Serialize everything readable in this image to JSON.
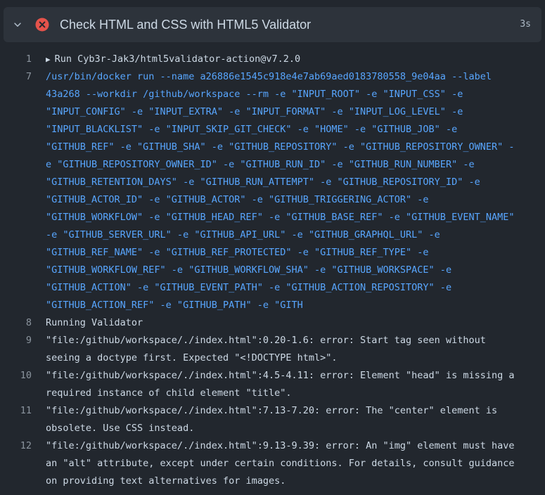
{
  "step": {
    "title": "Check HTML and CSS with HTML5 Validator",
    "duration": "3s",
    "status": "failed",
    "colors": {
      "failed": "#e5534b",
      "command": "#58a6ff",
      "text": "#cdd9e5",
      "line_number": "#8b949e",
      "background": "#22272e",
      "header_background": "#2d333b"
    }
  },
  "log": [
    {
      "number": "1",
      "kind": "group",
      "rows": [
        "Run Cyb3r-Jak3/html5validator-action@v7.2.0"
      ]
    },
    {
      "number": "7",
      "kind": "command",
      "rows": [
        "/usr/bin/docker run --name a26886e1545c918e4e7ab69aed0183780558_9e04aa --label",
        "43a268 --workdir /github/workspace --rm -e \"INPUT_ROOT\" -e \"INPUT_CSS\" -e",
        "\"INPUT_CONFIG\" -e \"INPUT_EXTRA\" -e \"INPUT_FORMAT\" -e \"INPUT_LOG_LEVEL\" -e",
        "\"INPUT_BLACKLIST\" -e \"INPUT_SKIP_GIT_CHECK\" -e \"HOME\" -e \"GITHUB_JOB\" -e",
        "\"GITHUB_REF\" -e \"GITHUB_SHA\" -e \"GITHUB_REPOSITORY\" -e \"GITHUB_REPOSITORY_OWNER\" -",
        "e \"GITHUB_REPOSITORY_OWNER_ID\" -e \"GITHUB_RUN_ID\" -e \"GITHUB_RUN_NUMBER\" -e",
        "\"GITHUB_RETENTION_DAYS\" -e \"GITHUB_RUN_ATTEMPT\" -e \"GITHUB_REPOSITORY_ID\" -e",
        "\"GITHUB_ACTOR_ID\" -e \"GITHUB_ACTOR\" -e \"GITHUB_TRIGGERING_ACTOR\" -e",
        "\"GITHUB_WORKFLOW\" -e \"GITHUB_HEAD_REF\" -e \"GITHUB_BASE_REF\" -e \"GITHUB_EVENT_NAME\"",
        "-e \"GITHUB_SERVER_URL\" -e \"GITHUB_API_URL\" -e \"GITHUB_GRAPHQL_URL\" -e",
        "\"GITHUB_REF_NAME\" -e \"GITHUB_REF_PROTECTED\" -e \"GITHUB_REF_TYPE\" -e",
        "\"GITHUB_WORKFLOW_REF\" -e \"GITHUB_WORKFLOW_SHA\" -e \"GITHUB_WORKSPACE\" -e",
        "\"GITHUB_ACTION\" -e \"GITHUB_EVENT_PATH\" -e \"GITHUB_ACTION_REPOSITORY\" -e",
        "\"GITHUB_ACTION_REF\" -e \"GITHUB_PATH\" -e \"GITH"
      ]
    },
    {
      "number": "8",
      "kind": "text",
      "rows": [
        "Running Validator"
      ]
    },
    {
      "number": "9",
      "kind": "text",
      "rows": [
        "\"file:/github/workspace/./index.html\":0.20-1.6: error: Start tag seen without",
        "seeing a doctype first. Expected \"<!DOCTYPE html>\"."
      ]
    },
    {
      "number": "10",
      "kind": "text",
      "rows": [
        "\"file:/github/workspace/./index.html\":4.5-4.11: error: Element \"head\" is missing a",
        "required instance of child element \"title\"."
      ]
    },
    {
      "number": "11",
      "kind": "text",
      "rows": [
        "\"file:/github/workspace/./index.html\":7.13-7.20: error: The \"center\" element is",
        "obsolete. Use CSS instead."
      ]
    },
    {
      "number": "12",
      "kind": "text",
      "rows": [
        "\"file:/github/workspace/./index.html\":9.13-9.39: error: An \"img\" element must have",
        "an \"alt\" attribute, except under certain conditions. For details, consult guidance",
        "on providing text alternatives for images."
      ]
    }
  ]
}
